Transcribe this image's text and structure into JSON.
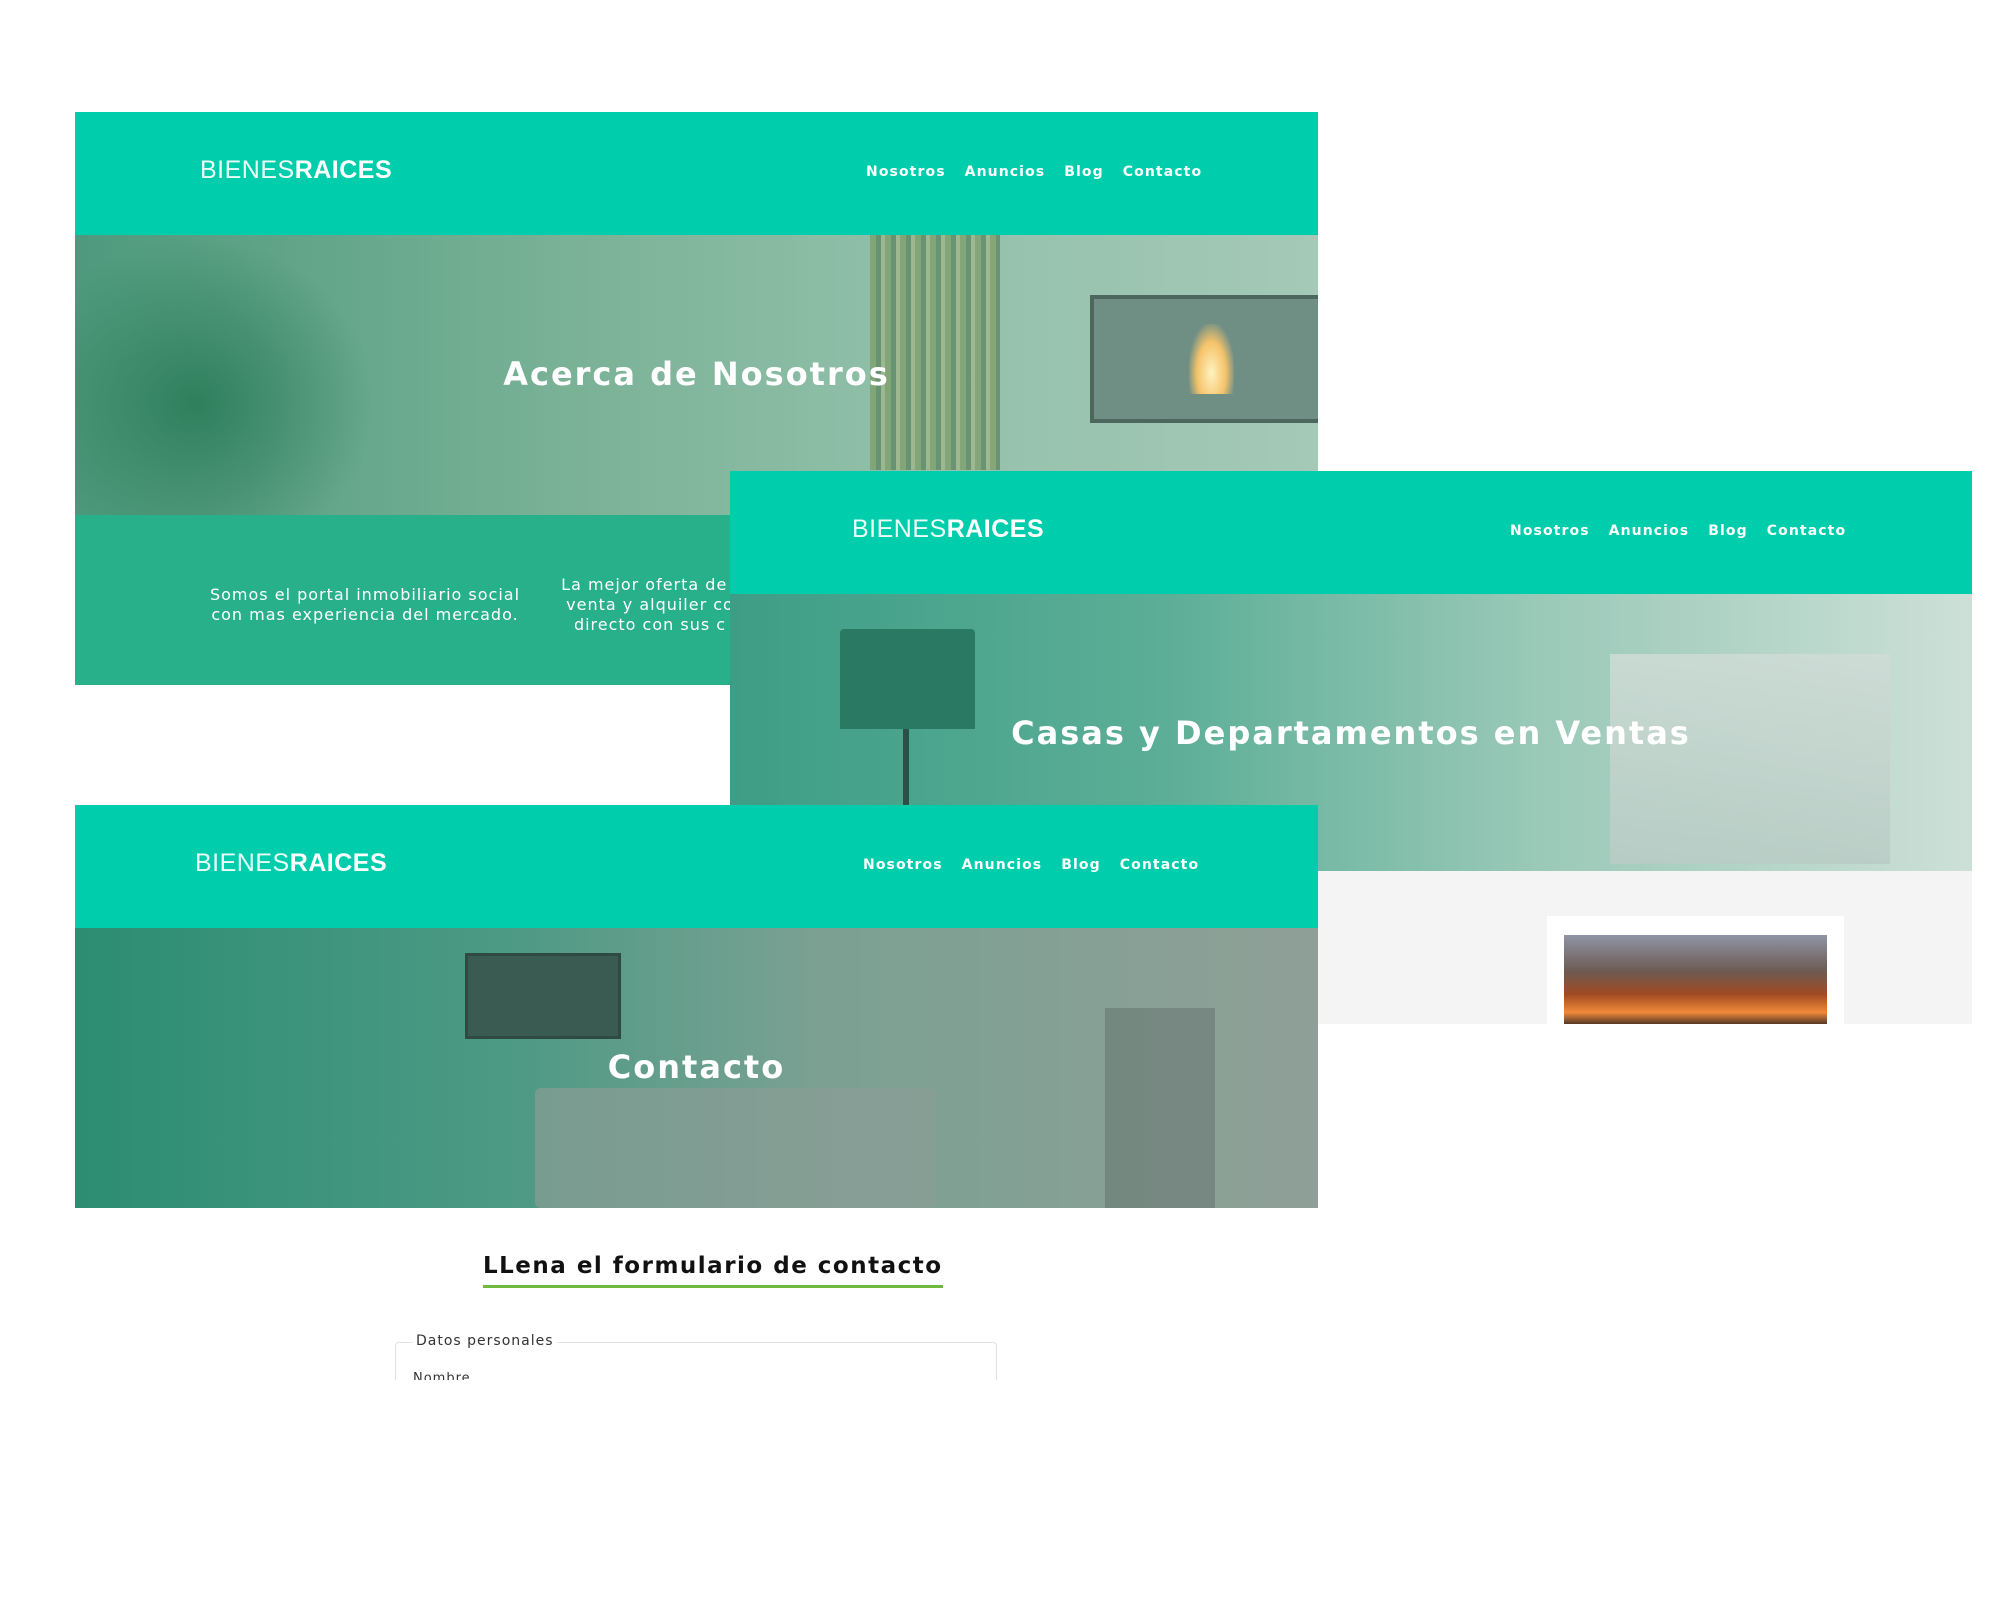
{
  "colors": {
    "header": "#00cdab",
    "band": "#27b08a",
    "underline": "#71b840"
  },
  "brand": {
    "thin": "BIENES",
    "bold": "RAICES"
  },
  "nav": [
    "Nosotros",
    "Anuncios",
    "Blog",
    "Contacto"
  ],
  "about_page": {
    "hero_title": "Acerca de Nosotros",
    "band": {
      "col1": "Somos el portal inmobiliario social con mas experiencia del mercado.",
      "col2": "La mejor oferta de i venta y alquiler co directo con sus c"
    }
  },
  "listings_page": {
    "hero_title": "Casas y Departamentos en Ventas"
  },
  "contact_page": {
    "hero_title": "Contacto",
    "form_title": "LLena el formulario de contacto",
    "fieldset_legend": "Datos personales",
    "first_field_label": "Nombre"
  }
}
